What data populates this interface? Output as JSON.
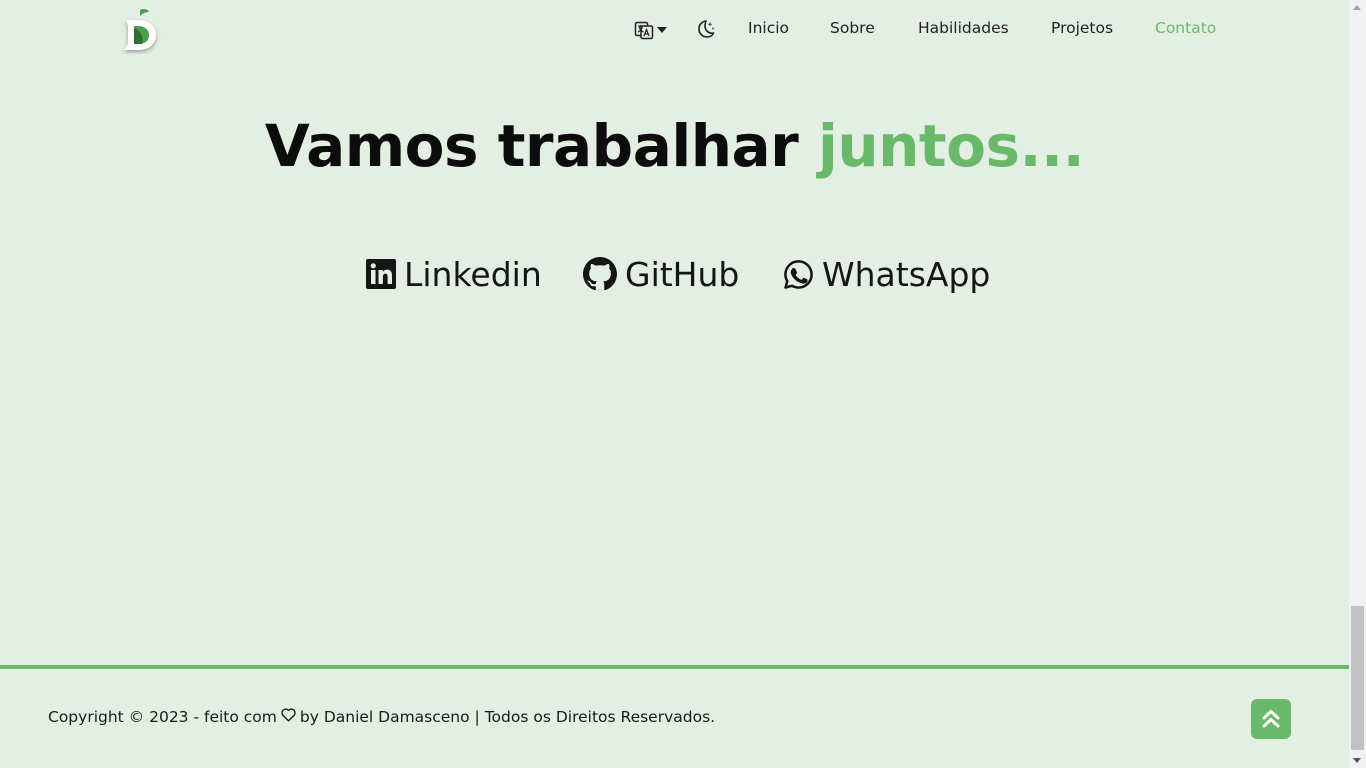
{
  "header": {
    "logo_alt": "D",
    "language_icon": "translate-icon",
    "theme_icon": "moon-icon",
    "nav": [
      {
        "label": "Inicio"
      },
      {
        "label": "Sobre"
      },
      {
        "label": "Habilidades"
      },
      {
        "label": "Projetos"
      },
      {
        "label": "Contato",
        "active": true
      }
    ]
  },
  "main": {
    "headline_prefix": "Vamos trabalhar ",
    "headline_accent": "juntos...",
    "social": [
      {
        "label": "Linkedin",
        "icon": "linkedin-icon"
      },
      {
        "label": "GitHub",
        "icon": "github-icon"
      },
      {
        "label": "WhatsApp",
        "icon": "whatsapp-icon"
      }
    ]
  },
  "footer": {
    "copyright_prefix": "Copyright © 2023 - feito com",
    "copyright_suffix": "by Daniel Damasceno | Todos os Direitos Reservados.",
    "back_to_top_icon": "double-chevron-up-icon"
  },
  "colors": {
    "background": "#e3efe3",
    "accent": "#6ab96b",
    "text": "#111111"
  }
}
